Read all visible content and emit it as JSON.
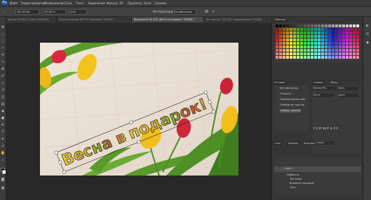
{
  "app": {
    "logo": "Ps"
  },
  "menu": [
    "Файл",
    "Редактирование",
    "Изображение",
    "Слои",
    "Текст",
    "Выделение",
    "Фильтр",
    "3D",
    "Просмотр",
    "Окно",
    "Справка"
  ],
  "options": {
    "w_value": "101,00 мм",
    "h_value": "100,00 %",
    "angle_value": "0,00",
    "interp": "Интерполяция",
    "interp_value": "Бикубическая",
    "cancel_icon": "cancel-icon",
    "commit_icon": "check-icon"
  },
  "tabs": [
    "фоторг @ 66% (Слой 0, RGB/8#)",
    "Прямоугольник @ 67% (Фоновый, RGB/8) *",
    "Выделение @ 50% (Весна в подарок!, RGB/8) *",
    "Без имени-1 @ 50%, кадрирование (RGB/8)"
  ],
  "document": {
    "headline_1": "Весна в",
    "headline_2": "подарок!"
  },
  "swatches_panel": {
    "tab_1": "Образцы"
  },
  "history_panel": {
    "tab": "История",
    "items": [
      "Без имени.jpg",
      "Открыть",
      "Прямоугольная обл.",
      "Свободное трансф.",
      "Свобод. трансф."
    ]
  },
  "char_panel": {
    "tab_1": "Символ",
    "tab_2": "Абзац",
    "font": "Myriad Pro",
    "style": "Bold",
    "size": "36 пт",
    "leading": "Авто",
    "lang": "Русский"
  },
  "layers_panel": {
    "tab_1": "Слои",
    "tab_2": "Каналы",
    "tab_3": "Контуры",
    "items": [
      "Слой 1",
      "Эффекты",
      "Тиснение",
      "Внешнее свечение",
      "Тень"
    ]
  },
  "colors": {
    "accent": "#1b4f8a",
    "bg": "#333333"
  }
}
